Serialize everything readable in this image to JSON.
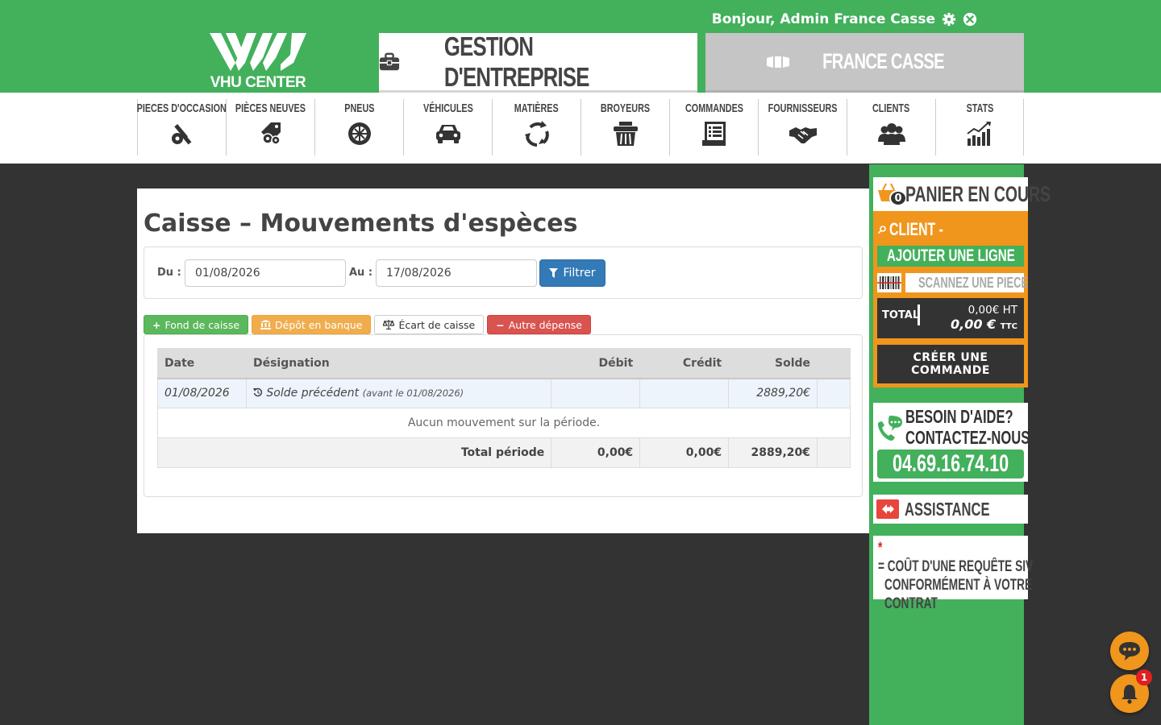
{
  "header": {
    "greeting": "Bonjour, Admin France Casse",
    "logo_text": "VHU CENTER",
    "tab_main": "GESTION D'ENTREPRISE",
    "tab_alt": "FRANCE CASSE"
  },
  "menu": {
    "items": [
      {
        "label": "PIECES D'OCCASION",
        "icon": "tools-icon"
      },
      {
        "label": "PIÈCES NEUVES",
        "icon": "tag-gears-icon"
      },
      {
        "label": "PNEUS",
        "icon": "tire-icon"
      },
      {
        "label": "VÉHICULES",
        "icon": "car-icon"
      },
      {
        "label": "MATIÈRES",
        "icon": "recycle-icon"
      },
      {
        "label": "BROYEURS",
        "icon": "crusher-icon"
      },
      {
        "label": "COMMANDES",
        "icon": "document-icon"
      },
      {
        "label": "FOURNISSEURS",
        "icon": "handshake-icon"
      },
      {
        "label": "CLIENTS",
        "icon": "users-icon"
      },
      {
        "label": "STATS",
        "icon": "chart-icon"
      }
    ]
  },
  "main": {
    "title": "Caisse – Mouvements d'espèces",
    "filter": {
      "from_label": "Du :",
      "from_value": "01/08/2026",
      "to_label": "Au :",
      "to_value": "17/08/2026",
      "button": "Filtrer"
    },
    "actions": {
      "fond": "Fond de caisse",
      "depot": "Dépôt en banque",
      "ecart": "Écart de caisse",
      "autre": "Autre dépense"
    },
    "table": {
      "headers": [
        "Date",
        "Désignation",
        "Débit",
        "Crédit",
        "Solde"
      ],
      "prev_row": {
        "date": "01/08/2026",
        "designation": "Solde précédent",
        "note": "(avant le 01/08/2026)",
        "debit": "",
        "credit": "",
        "solde": "2889,20€"
      },
      "empty_message": "Aucun mouvement sur la période.",
      "total_row": {
        "label": "Total période",
        "debit": "0,00€",
        "credit": "0,00€",
        "solde": "2889,20€"
      }
    }
  },
  "sidebar": {
    "cart_count": "0",
    "cart_title": "PANIER EN COURS",
    "client_label": "CLIENT -",
    "add_line": "AJOUTER UNE LIGNE",
    "scan_placeholder": "SCANNEZ UNE PIECE",
    "total_label": "TOTAL",
    "total_ht": "0,00€ HT",
    "total_ttc": "0,00 €",
    "total_ttc_suffix": "TTC",
    "create_order_1": "CRÉER UNE",
    "create_order_2": "COMMANDE",
    "help_1": "BESOIN D'AIDE?",
    "help_2": "CONTACTEZ-NOUS",
    "phone": "04.69.16.74.10",
    "assistance": "ASSISTANCE",
    "note_star": "*",
    "note_1": "= COÛT D'UNE REQUÊTE SIV",
    "note_2": "CONFORMÉMENT À VOTRE",
    "note_3": "CONTRAT"
  },
  "notifications": {
    "count": "1"
  },
  "colors": {
    "brand_green": "#43b05c",
    "accent_orange": "#f0961c",
    "dark": "#333333"
  }
}
